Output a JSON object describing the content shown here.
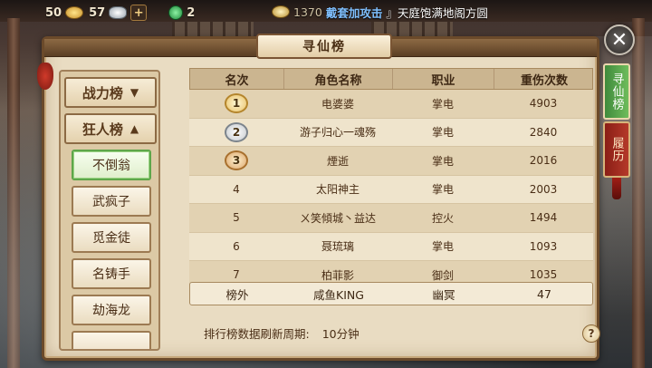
{
  "topbar": {
    "gold": "50",
    "silver": "57",
    "jade": "2",
    "news_num": "1370",
    "news_highlight": "戴套加攻击",
    "news_text": "』天庭饱满地阁方圆"
  },
  "panel": {
    "title": "寻仙榜"
  },
  "categories": {
    "combat": "战力榜",
    "crazy": "狂人榜",
    "subs": [
      "不倒翁",
      "武疯子",
      "觅金徒",
      "名铸手",
      "劫海龙"
    ]
  },
  "table": {
    "headers": [
      "名次",
      "角色名称",
      "职业",
      "重伤次数"
    ],
    "rows": [
      {
        "rank": "1",
        "name": "电婆婆",
        "job": "掌电",
        "count": "4903"
      },
      {
        "rank": "2",
        "name": "游子归心一魂殇",
        "job": "掌电",
        "count": "2840"
      },
      {
        "rank": "3",
        "name": "煙逝",
        "job": "掌电",
        "count": "2016"
      },
      {
        "rank": "4",
        "name": "太阳神主",
        "job": "掌电",
        "count": "2003"
      },
      {
        "rank": "5",
        "name": "ㄨ笑傾城丶益达",
        "job": "控火",
        "count": "1494"
      },
      {
        "rank": "6",
        "name": "聂琉璃",
        "job": "掌电",
        "count": "1093"
      },
      {
        "rank": "7",
        "name": "柏菲影",
        "job": "御剑",
        "count": "1035"
      }
    ],
    "mine": {
      "rank": "榜外",
      "name": "咸鱼KING",
      "job": "幽冥",
      "count": "47"
    }
  },
  "footer": {
    "label": "排行榜数据刷新周期:",
    "value": "10分钟",
    "help": "?"
  },
  "tabs": {
    "seek": "寻仙榜",
    "history": "履历"
  },
  "close_symbol": "✕"
}
